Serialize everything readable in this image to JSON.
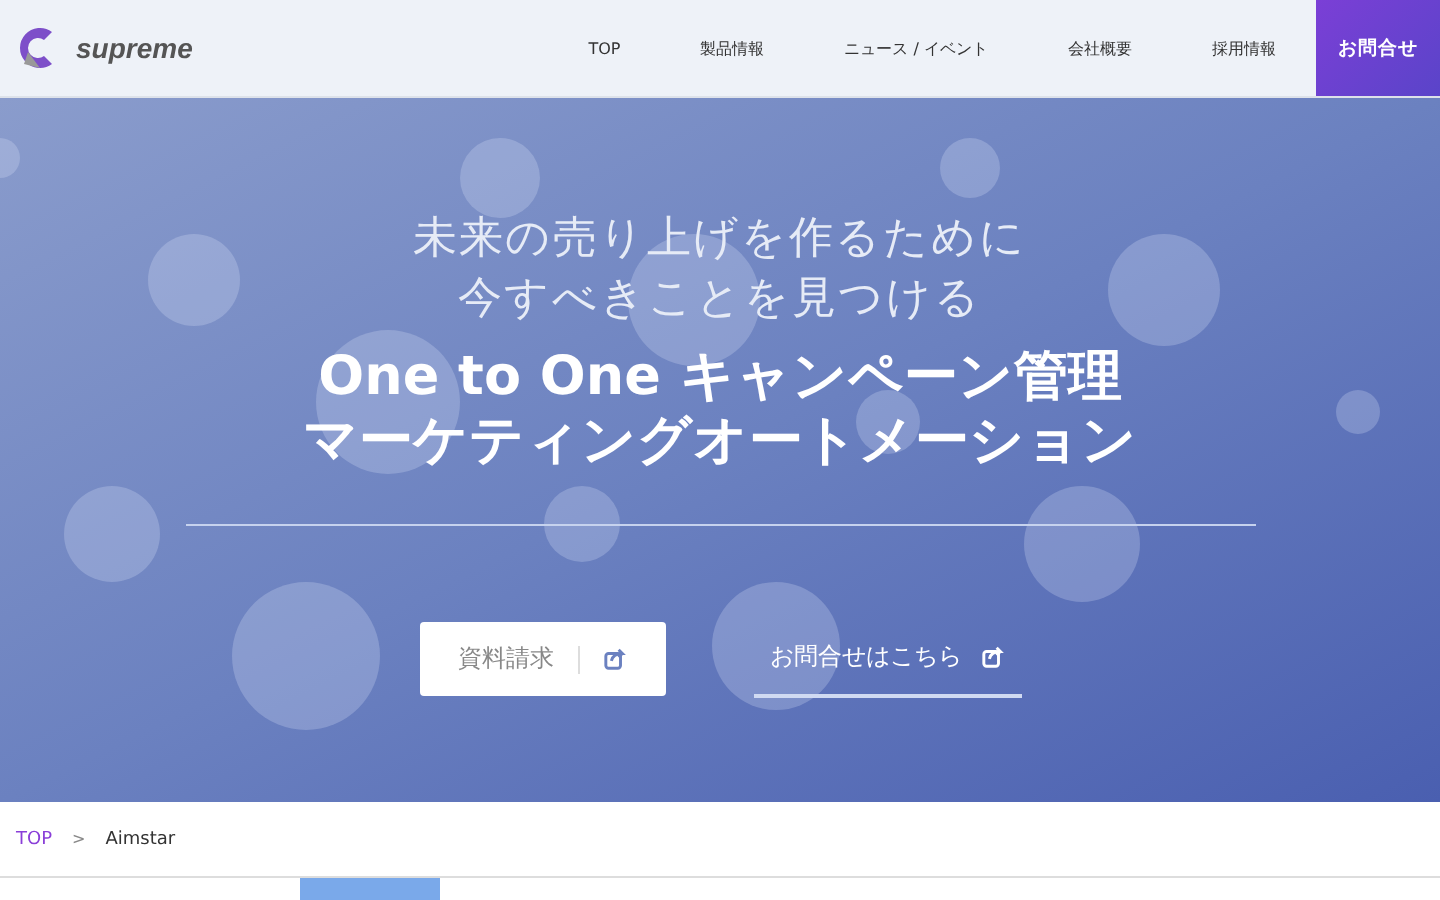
{
  "header": {
    "logo": "supreme",
    "nav": [
      {
        "label": "TOP",
        "kind": "link"
      },
      {
        "label": "製品情報",
        "kind": "link"
      },
      {
        "label": "ニュース / イベント",
        "kind": "link"
      },
      {
        "label": "会社概要",
        "kind": "link"
      },
      {
        "label": "採用情報",
        "kind": "link"
      },
      {
        "label": "お問合せ",
        "kind": "cta"
      }
    ]
  },
  "hero": {
    "kind": "picture",
    "subtitle": [
      "未来の売り上げを作るために",
      "今すべきことを見つける"
    ],
    "title": [
      "One to One キャンペーン管理",
      "マーケティングオートメーション"
    ],
    "buttons": [
      {
        "label": "資料請求",
        "kind": "solid"
      },
      {
        "label": "お問合せはこちら",
        "kind": "underline"
      }
    ]
  },
  "breadcrumb": [
    {
      "label": "TOP",
      "kind": "link"
    },
    {
      "label": "Aimstar",
      "kind": "current"
    }
  ],
  "breadcrumb_separator": ">"
}
